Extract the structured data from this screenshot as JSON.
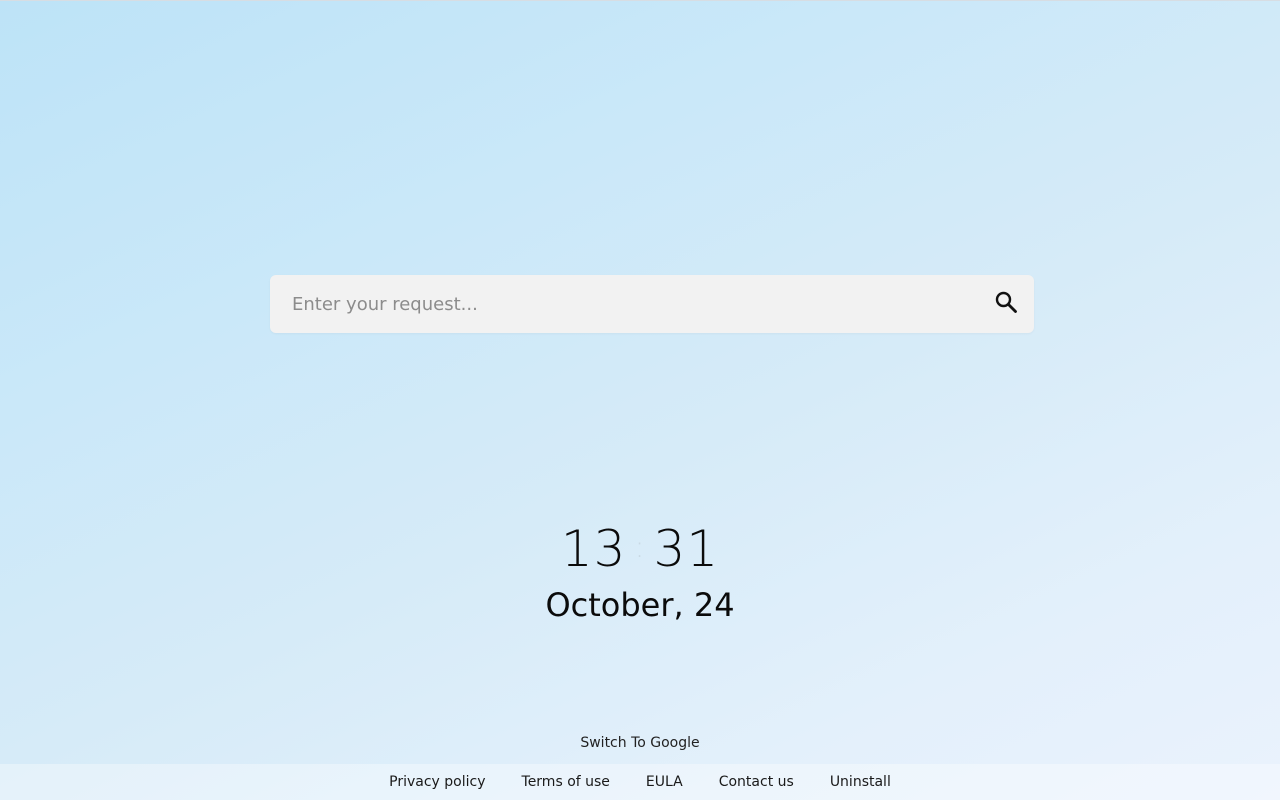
{
  "search": {
    "placeholder": "Enter your request...",
    "value": ""
  },
  "clock": {
    "hours": "13",
    "separator": ":",
    "minutes": "31"
  },
  "date": "October, 24",
  "switch_link": "Switch To Google",
  "footer": {
    "links": [
      "Privacy policy",
      "Terms of use",
      "EULA",
      "Contact us",
      "Uninstall"
    ]
  },
  "icons": {
    "search": "search-icon"
  },
  "colors": {
    "search_box": "#f2f2f2",
    "text": "#0b0b0b",
    "clock_separator": "#c9d9e4"
  }
}
